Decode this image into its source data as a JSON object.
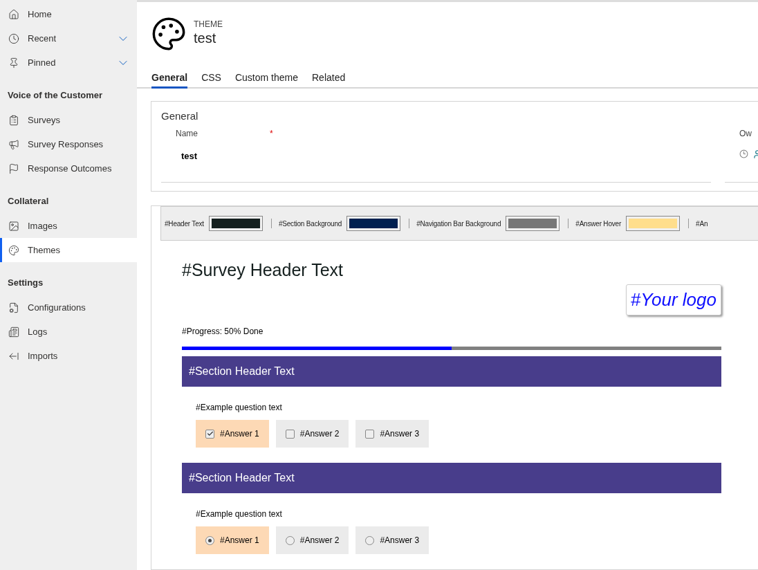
{
  "sidebar": {
    "groups": [
      {
        "items": [
          {
            "label": "Home",
            "selected": false
          },
          {
            "label": "Recent",
            "selected": false,
            "expanded": false
          },
          {
            "label": "Pinned",
            "selected": false,
            "expanded": false
          }
        ]
      },
      {
        "heading": "Voice of the Customer",
        "items": [
          {
            "label": "Surveys",
            "selected": false
          },
          {
            "label": "Survey Responses",
            "selected": false
          },
          {
            "label": "Response Outcomes",
            "selected": false
          }
        ]
      },
      {
        "heading": "Collateral",
        "items": [
          {
            "label": "Images",
            "selected": false
          },
          {
            "label": "Themes",
            "selected": true
          }
        ]
      },
      {
        "heading": "Settings",
        "items": [
          {
            "label": "Configurations",
            "selected": false
          },
          {
            "label": "Logs",
            "selected": false
          },
          {
            "label": "Imports",
            "selected": false
          }
        ]
      }
    ]
  },
  "record": {
    "entity": "THEME",
    "title": "test"
  },
  "tabs": [
    {
      "label": "General",
      "selected": true
    },
    {
      "label": "CSS",
      "selected": false
    },
    {
      "label": "Custom theme",
      "selected": false
    },
    {
      "label": "Related",
      "selected": false
    }
  ],
  "general": {
    "title": "General",
    "fields": [
      {
        "label": "Name",
        "required_mark": "*",
        "value": "test"
      },
      {
        "label": "Ow"
      }
    ]
  },
  "swatches": [
    {
      "label": "#Header Text",
      "color": "#141f1e"
    },
    {
      "label": "#Section Background",
      "color": "#002050"
    },
    {
      "label": "#Navigation Bar Background",
      "color": "#777777"
    },
    {
      "label": "#Answer Hover",
      "color": "#ffde8c"
    },
    {
      "label": "#An"
    }
  ],
  "preview": {
    "header": "#Survey Header Text",
    "logo": "#Your logo",
    "progress": {
      "label": "#Progress: 50% Done",
      "level": 0.5
    },
    "sections": [
      {
        "title": "#Section Header Text",
        "question": "#Example question text",
        "kind": "checkbox",
        "answers": [
          {
            "label": "#Answer 1",
            "selected": true
          },
          {
            "label": "#Answer 2",
            "selected": false
          },
          {
            "label": "#Answer 3",
            "selected": false
          }
        ]
      },
      {
        "title": "#Section Header Text",
        "question": "#Example question text",
        "kind": "radio",
        "answers": [
          {
            "label": "#Answer 1",
            "selected": true
          },
          {
            "label": "#Answer 2",
            "selected": false
          },
          {
            "label": "#Answer 3",
            "selected": false
          }
        ]
      }
    ]
  }
}
